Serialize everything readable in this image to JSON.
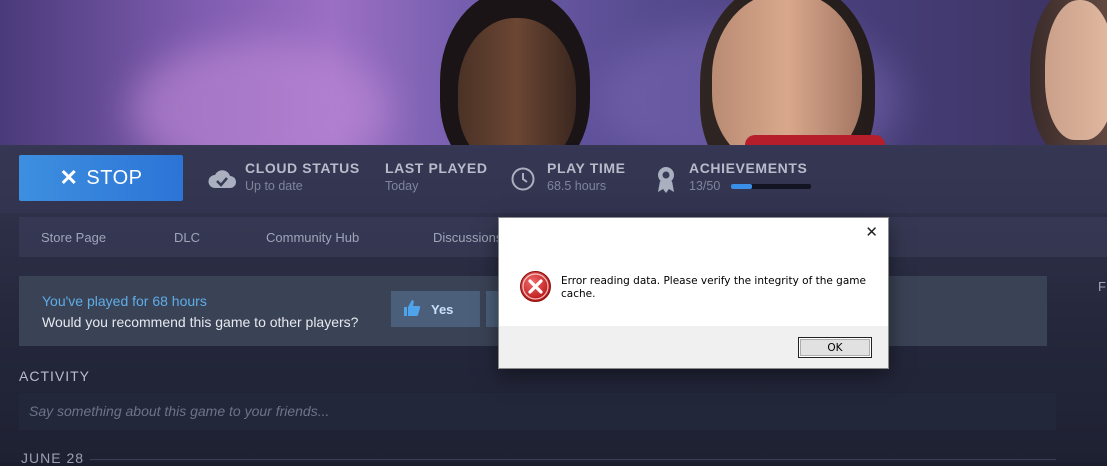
{
  "header": {
    "stop_label": "STOP",
    "stats": [
      {
        "label": "CLOUD STATUS",
        "value": "Up to date",
        "icon": "cloud-check-icon"
      },
      {
        "label": "LAST PLAYED",
        "value": "Today"
      },
      {
        "label": "PLAY TIME",
        "value": "68.5 hours",
        "icon": "clock-icon"
      },
      {
        "label": "ACHIEVEMENTS",
        "value": "13/50",
        "icon": "achievement-icon",
        "progress": 0.26
      }
    ],
    "accent": "#3d8fe0"
  },
  "nav": [
    "Store Page",
    "DLC",
    "Community Hub",
    "Discussions"
  ],
  "recommend": {
    "hours_text": "You've played for 68 hours",
    "question": "Would you recommend this game to other players?",
    "yes_label": "Yes"
  },
  "activity": {
    "heading": "ACTIVITY",
    "placeholder": "Say something about this game to your friends..."
  },
  "feed": {
    "date": "JUNE 28"
  },
  "right_fragment": "F",
  "dialog": {
    "message": "Error reading data. Please verify the integrity of the game cache.",
    "ok_label": "OK",
    "close_glyph": "✕"
  }
}
